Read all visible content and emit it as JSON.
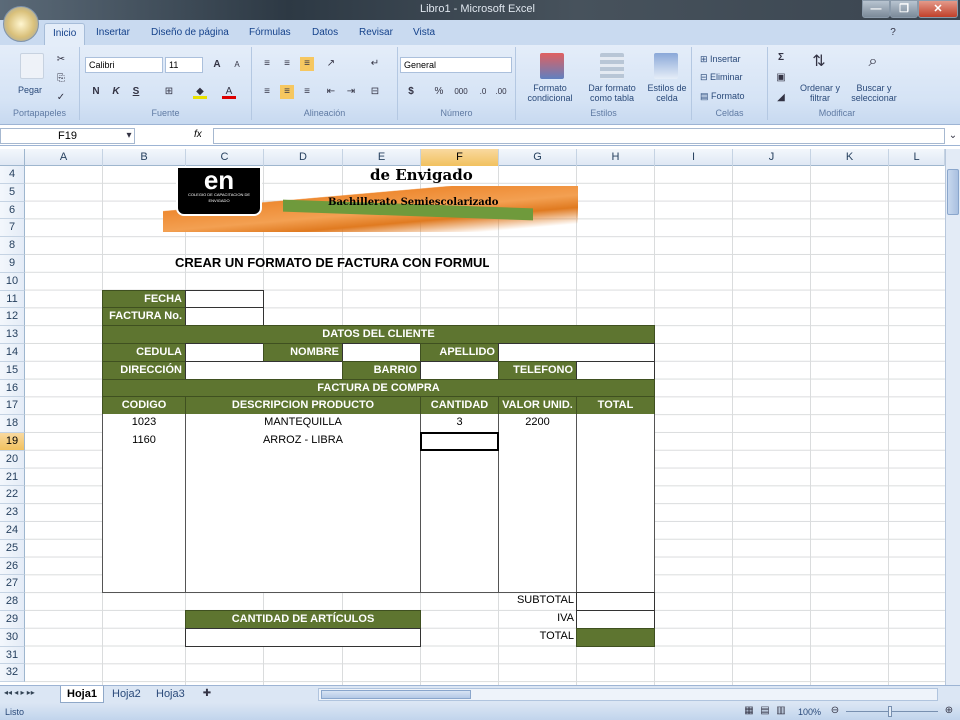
{
  "window": {
    "title": "Libro1 - Microsoft Excel",
    "minimize": "—",
    "maximize": "❐",
    "close": "✕"
  },
  "tabs": [
    "Inicio",
    "Insertar",
    "Diseño de página",
    "Fórmulas",
    "Datos",
    "Revisar",
    "Vista"
  ],
  "ribbon": {
    "clipboard": {
      "paste": "Pegar",
      "label": "Portapapeles"
    },
    "font": {
      "name": "Calibri",
      "size": "11",
      "bold": "N",
      "italic": "K",
      "underline": "S",
      "label": "Fuente"
    },
    "alignment": {
      "label": "Alineación"
    },
    "number": {
      "format": "General",
      "currency": "$",
      "percent": "%",
      "thousands": "000",
      "label": "Número"
    },
    "styles": {
      "conditional": "Formato condicional",
      "as_table": "Dar formato como tabla",
      "cell_styles": "Estilos de celda",
      "label": "Estilos"
    },
    "cells": {
      "insert": "Insertar",
      "delete": "Eliminar",
      "format": "Formato",
      "label": "Celdas"
    },
    "editing": {
      "sum": "Σ",
      "sort": "Ordenar y filtrar",
      "find": "Buscar y seleccionar",
      "label": "Modificar"
    }
  },
  "formula_bar": {
    "name_box": "F19",
    "fx": "fx",
    "value": ""
  },
  "columns": [
    "A",
    "B",
    "C",
    "D",
    "E",
    "F",
    "G",
    "H",
    "I",
    "J",
    "K",
    "L"
  ],
  "selected_cell": "F19",
  "rows": [
    4,
    5,
    6,
    7,
    8,
    9,
    10,
    11,
    12,
    13,
    14,
    15,
    16,
    17,
    18,
    19,
    20,
    21,
    22,
    23,
    24,
    25,
    26,
    27,
    28,
    29,
    30,
    31,
    32
  ],
  "logo": {
    "mark": "en",
    "school_line": "COLEGIO DE CAPACITACION DE ENVIGADO",
    "title": "de Envigado",
    "subtitle": "Bachillerato Semiescolarizado"
  },
  "sheet": {
    "title": "CREAR UN FORMATO DE FACTURA CON FORMULAS",
    "fecha": "FECHA",
    "factura_no": "FACTURA No.",
    "datos_cliente": "DATOS DEL CLIENTE",
    "cedula": "CEDULA",
    "nombre": "NOMBRE",
    "apellido": "APELLIDO",
    "direccion": "DIRECCIÓN",
    "barrio": "BARRIO",
    "telefono": "TELEFONO",
    "factura_compra": "FACTURA DE COMPRA",
    "headers": {
      "codigo": "CODIGO",
      "descripcion": "DESCRIPCION PRODUCTO",
      "cantidad": "CANTIDAD",
      "valor": "VALOR UNID.",
      "total": "TOTAL"
    },
    "items": [
      {
        "codigo": "1023",
        "descripcion": "MANTEQUILLA",
        "cantidad": "3",
        "valor": "2200",
        "total": ""
      },
      {
        "codigo": "1160",
        "descripcion": "ARROZ - LIBRA",
        "cantidad": "",
        "valor": "",
        "total": ""
      }
    ],
    "subtotal": "SUBTOTAL",
    "iva": "IVA",
    "total": "TOTAL",
    "cantidad_articulos": "CANTIDAD DE ARTÍCULOS"
  },
  "sheet_tabs": [
    "Hoja1",
    "Hoja2",
    "Hoja3"
  ],
  "status": {
    "mode": "Listo",
    "zoom": "100%"
  }
}
